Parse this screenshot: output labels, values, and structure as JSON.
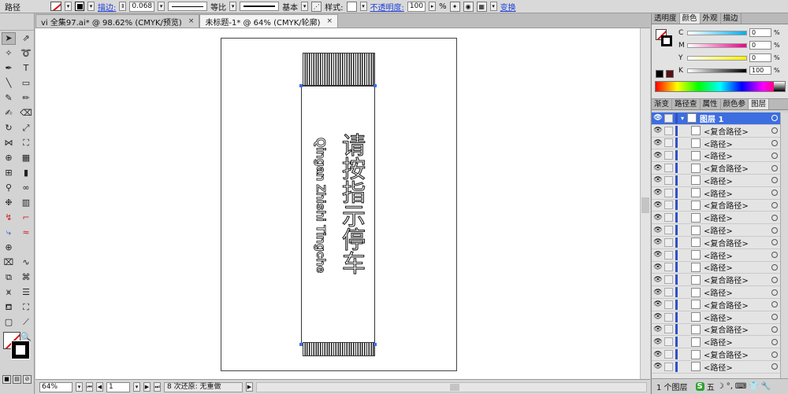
{
  "control_bar": {
    "object_type": "路径",
    "stroke_label": "描边:",
    "stroke_weight": "0.068",
    "profile_label": "等比",
    "brush_label": "基本",
    "style_label": "样式:",
    "opacity_label": "不透明度:",
    "opacity_value": "100",
    "opacity_unit": "%",
    "transform_label": "变换"
  },
  "tabs": [
    {
      "label": "vi 全集97.ai* @ 98.62% (CMYK/预览)",
      "close": "×"
    },
    {
      "label": "未标题-1* @ 64% (CMYK/轮廓)",
      "close": "×"
    }
  ],
  "artwork": {
    "chinese_text": "请按指示停车",
    "pinyin_text": "Qingan Zhishi Tingche"
  },
  "status_bar": {
    "zoom": "64%",
    "page": "1",
    "status": "8 次还原: 无重做"
  },
  "color_panel": {
    "tabs": [
      "透明度",
      "颜色",
      "外观",
      "描边"
    ],
    "active_tab": "颜色",
    "channels": [
      {
        "key": "C",
        "value": "0",
        "unit": "%"
      },
      {
        "key": "M",
        "value": "0",
        "unit": "%"
      },
      {
        "key": "Y",
        "value": "0",
        "unit": "%"
      },
      {
        "key": "K",
        "value": "100",
        "unit": "%"
      }
    ]
  },
  "layers_panel": {
    "tabs": [
      "渐变",
      "路径查",
      "属性",
      "颜色参",
      "图层"
    ],
    "active_tab": "图层",
    "layer_name": "图层 1",
    "items": [
      "<复合路径>",
      "<路径>",
      "<路径>",
      "<复合路径>",
      "<路径>",
      "<路径>",
      "<复合路径>",
      "<路径>",
      "<路径>",
      "<复合路径>",
      "<路径>",
      "<路径>",
      "<复合路径>",
      "<路径>",
      "<复合路径>",
      "<路径>",
      "<复合路径>",
      "<路径>",
      "<复合路径>",
      "<路径>"
    ],
    "footer": "1 个图层"
  },
  "ime_bar": [
    "五",
    "☽",
    "°,",
    "⌨",
    "👕",
    "🔧"
  ],
  "colors": {
    "selection_blue": "#3d6ee0",
    "link_blue": "#1f3fd6",
    "none_red": "#dd1111"
  }
}
